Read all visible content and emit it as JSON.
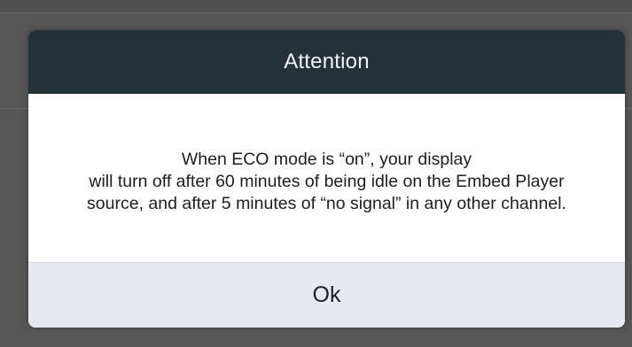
{
  "dialog": {
    "title": "Attention",
    "message_lines": [
      "When ECO mode is “on”, your display",
      "will turn off after 60 minutes of being idle on the Embed Player",
      "source, and after 5 minutes of “no signal” in any other channel."
    ],
    "ok_label": "Ok"
  },
  "colors": {
    "header_bg": "#253338",
    "footer_bg": "#e6e9f0",
    "overlay_bg": "#565656"
  }
}
